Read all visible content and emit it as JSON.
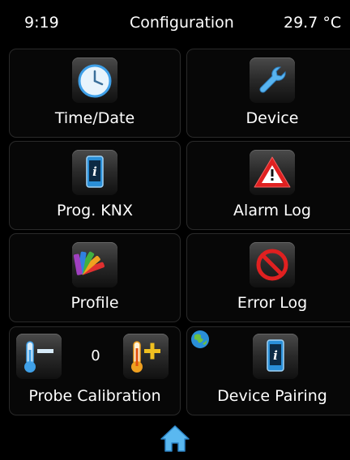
{
  "status_bar": {
    "time": "9:19",
    "title": "Configuration",
    "temperature": "29.7 °C"
  },
  "tiles": [
    {
      "label": "Time/Date",
      "icon": "clock-icon"
    },
    {
      "label": "Device",
      "icon": "wrench-icon"
    },
    {
      "label": "Prog. KNX",
      "icon": "phone-info-icon"
    },
    {
      "label": "Alarm Log",
      "icon": "warning-triangle-icon"
    },
    {
      "label": "Profile",
      "icon": "color-palette-icon"
    },
    {
      "label": "Error Log",
      "icon": "prohibited-icon"
    },
    {
      "label": "Probe Calibration",
      "icon_left": "thermometer-minus-icon",
      "icon_right": "thermometer-plus-icon",
      "value": "0"
    },
    {
      "label": "Device Pairing",
      "icon": "phone-info-icon",
      "badge_icon": "globe-icon"
    }
  ],
  "nav": {
    "home_icon": "home-icon"
  },
  "colors": {
    "background": "#000000",
    "tile_border": "#2a2a2a",
    "accent_blue": "#3fa0e8",
    "alert_red": "#e02020",
    "thermo_orange": "#f0a020"
  }
}
